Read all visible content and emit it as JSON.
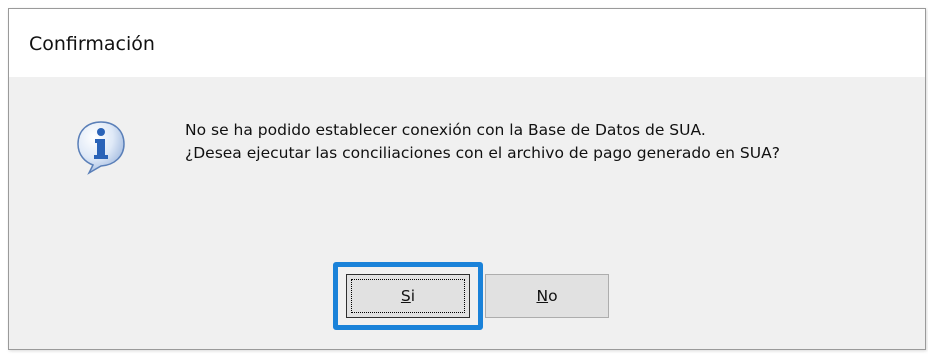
{
  "dialog": {
    "title": "Confirmación",
    "icon": "info-icon",
    "message_lines": [
      "No se ha podido establecer conexión con la Base de Datos de SUA.",
      "¿Desea ejecutar las conciliaciones con el archivo de pago generado en SUA?"
    ],
    "buttons": {
      "yes": {
        "accel": "S",
        "rest": "i",
        "label": "Si",
        "focused": true
      },
      "no": {
        "accel": "N",
        "rest": "o",
        "label": "No"
      }
    },
    "colors": {
      "focus_highlight": "#1a82d9",
      "icon_blue": "#2a63b8",
      "dialog_bg": "#f0f0f0",
      "titlebar_bg": "#ffffff"
    }
  }
}
